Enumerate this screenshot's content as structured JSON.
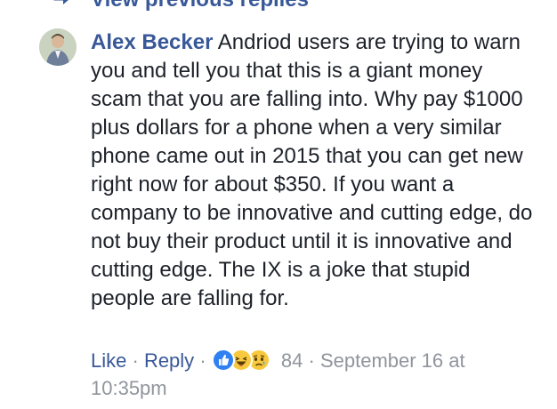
{
  "previous_replies": {
    "label": "View previous replies"
  },
  "comment": {
    "author": "Alex Becker",
    "text": "Andriod users are trying to warn you and tell you that this is a giant money scam that you are falling into. Why pay $1000 plus dollars for a phone when a very similar phone came out in 2015 that you can get new right now for about $350. If you want a company to be innovative and cutting edge, do not buy their product until it is innovative and cutting edge. The IX is a joke that stupid people are falling for."
  },
  "actions": {
    "like_label": "Like",
    "reply_label": "Reply",
    "separator": "·",
    "reaction_count": "84",
    "timestamp": "September 16 at 10:35pm",
    "reaction_icons": [
      "like-reaction-icon",
      "haha-reaction-icon",
      "sad-reaction-icon"
    ]
  },
  "colors": {
    "link": "#385898",
    "text": "#1d2129",
    "meta": "#90949c",
    "like_blue": "#2f80f3",
    "emoji_yellow": "#f7c93e"
  }
}
